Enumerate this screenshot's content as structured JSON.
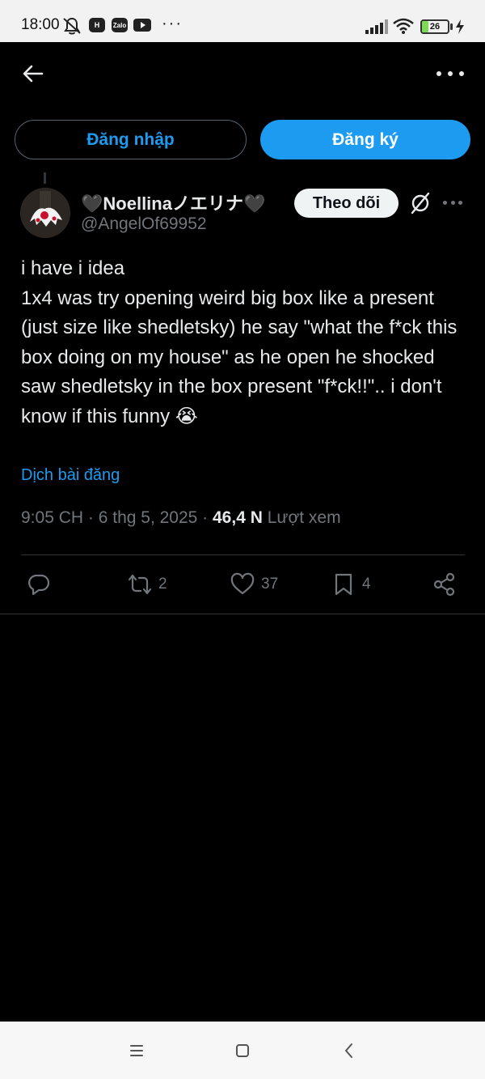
{
  "status_bar": {
    "time": "18:00",
    "app_badges": [
      "H",
      "Zalo"
    ],
    "overflow": "···",
    "battery": "26",
    "battery_level": 0.26
  },
  "auth": {
    "login_label": "Đăng nhập",
    "signup_label": "Đăng ký"
  },
  "tweet": {
    "display_name": "🖤Noellinaノエリナ🖤",
    "handle": "@AngelOf69952",
    "follow_label": "Theo dõi",
    "text": "i have i idea\n1x4 was try opening weird big box like a present (just size like shedletsky) he say \"what the f*ck this box doing on my house\" as he open he shocked saw shedletsky in the box present \"f*ck!!\".. i don't know if this funny 😭",
    "translate_label": "Dịch bài đăng",
    "time": "9:05 CH",
    "separator": " · ",
    "date": "6 thg 5, 2025",
    "views_count": "46,4 N",
    "views_label": "Lượt xem",
    "retweets": "2",
    "likes": "37",
    "bookmarks": "4"
  },
  "colors": {
    "accent": "#1d9bf0",
    "background": "#000000",
    "text": "#e7e9ea",
    "muted": "#71767b"
  }
}
